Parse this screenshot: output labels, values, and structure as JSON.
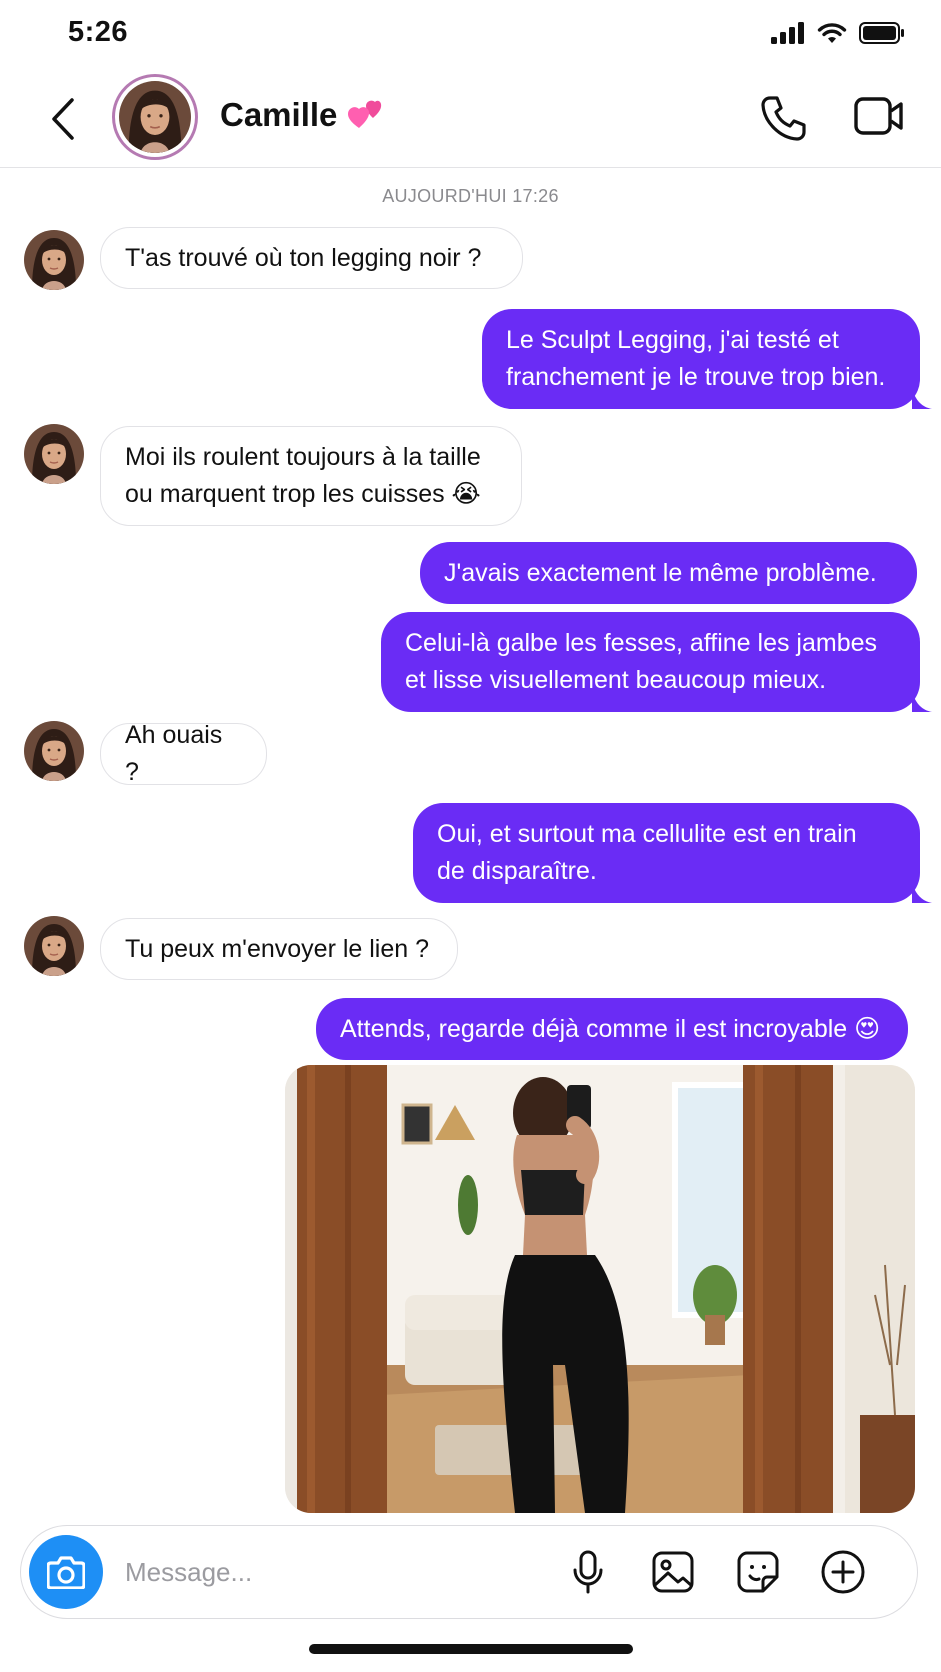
{
  "status_bar": {
    "time": "5:26",
    "icons": [
      "signal-icon",
      "wifi-icon",
      "battery-icon"
    ]
  },
  "header": {
    "back_icon": "chevron-left-icon",
    "contact_name": "Camille",
    "name_emoji": "💞",
    "actions": [
      "phone-icon",
      "video-camera-icon"
    ],
    "avatar_ring_color": "#b57ab2"
  },
  "conversation": {
    "timestamp": "AUJOURD'HUI 17:26",
    "messages": [
      {
        "from": "contact",
        "text": "T'as trouvé où ton legging noir ?"
      },
      {
        "from": "me",
        "text": "Le Sculpt Legging, j'ai testé et\nfranchement je le trouve trop bien."
      },
      {
        "from": "contact",
        "text": "Moi ils roulent toujours à la taille\nou marquent trop les cuisses 😭"
      },
      {
        "from": "me",
        "text": "J'avais exactement le même problème."
      },
      {
        "from": "me",
        "text": "Celui-là galbe les fesses, affine les jambes\net lisse visuellement beaucoup mieux."
      },
      {
        "from": "contact",
        "text": "Ah ouais ?"
      },
      {
        "from": "me",
        "text": "Oui, et surtout ma cellulite est en train\nde disparaître."
      },
      {
        "from": "contact",
        "text": "Tu peux m'envoyer le lien ?"
      },
      {
        "from": "me",
        "text": "Attends, regarde déjà comme il est incroyable 😍"
      },
      {
        "from": "me",
        "type": "photo",
        "description": "mirror selfie in black leggings"
      }
    ]
  },
  "composer": {
    "placeholder": "Message...",
    "camera_icon": "camera-icon",
    "tools": [
      "microphone-icon",
      "image-icon",
      "sticker-icon",
      "plus-circle-icon"
    ]
  },
  "colors": {
    "outgoing_bubble": "#6a2cf5",
    "incoming_border": "#e2e2e6",
    "camera_button": "#1e8ff5",
    "timestamp_text": "#8a8a8e"
  }
}
